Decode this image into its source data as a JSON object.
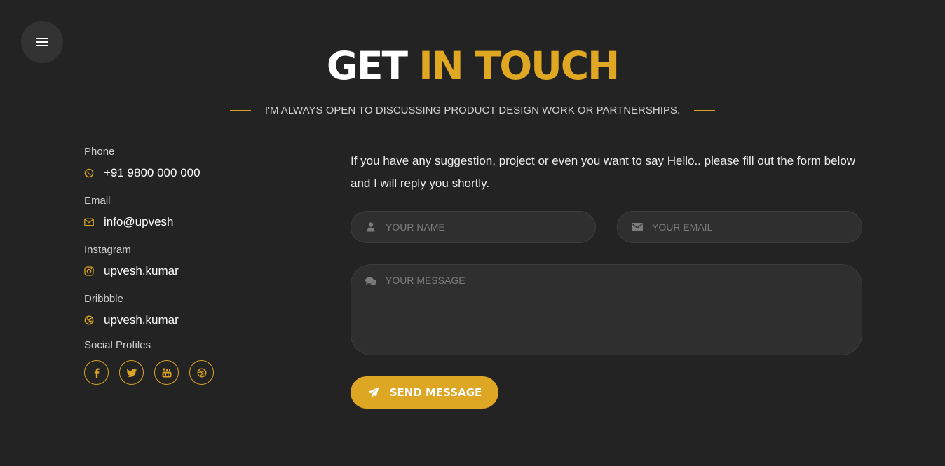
{
  "nav": {
    "menu_icon": "hamburger-icon"
  },
  "header": {
    "title_part1": "GET",
    "title_part2": "IN TOUCH",
    "subtitle": "I'M ALWAYS OPEN TO DISCUSSING PRODUCT DESIGN WORK OR PARTNERSHIPS."
  },
  "contact": {
    "items": [
      {
        "label": "Phone",
        "value": "+91 9800 000 000",
        "icon": "whatsapp-icon"
      },
      {
        "label": "Email",
        "value": "info@upvesh",
        "icon": "envelope-icon"
      },
      {
        "label": "Instagram",
        "value": "upvesh.kumar",
        "icon": "instagram-icon"
      },
      {
        "label": "Dribbble",
        "value": "upvesh.kumar",
        "icon": "dribbble-icon"
      }
    ],
    "social_label": "Social Profiles",
    "social": [
      "facebook-icon",
      "twitter-icon",
      "youtube-icon",
      "dribbble-icon"
    ]
  },
  "form": {
    "intro": "If you have any suggestion, project or even you want to say Hello.. please fill out the form below and I will reply you shortly.",
    "name_placeholder": "YOUR NAME",
    "email_placeholder": "YOUR EMAIL",
    "message_placeholder": "YOUR MESSAGE",
    "name_value": "",
    "email_value": "",
    "message_value": "",
    "submit_label": "SEND MESSAGE"
  },
  "colors": {
    "background": "#232323",
    "accent": "#dda623",
    "field_bg": "#2f2f2f",
    "menu_bg": "#333333"
  }
}
